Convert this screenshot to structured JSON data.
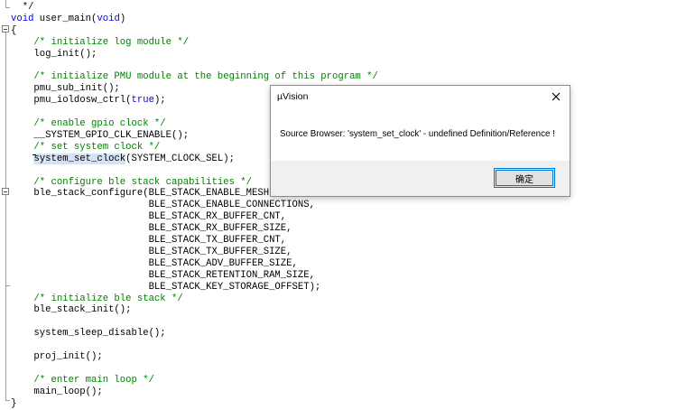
{
  "editor": {
    "lines": [
      {
        "segs": [
          {
            "t": "  */",
            "c": "plain"
          }
        ]
      },
      {
        "segs": [
          {
            "t": "void",
            "c": "keyword"
          },
          {
            "t": " user_main(",
            "c": "plain"
          },
          {
            "t": "void",
            "c": "keyword"
          },
          {
            "t": ")",
            "c": "plain"
          }
        ]
      },
      {
        "segs": [
          {
            "t": "{",
            "c": "plain"
          }
        ]
      },
      {
        "segs": [
          {
            "t": "    /* initialize log module */",
            "c": "comment"
          }
        ]
      },
      {
        "segs": [
          {
            "t": "    log_init();",
            "c": "plain"
          }
        ]
      },
      {
        "segs": [
          {
            "t": "",
            "c": "plain"
          }
        ]
      },
      {
        "segs": [
          {
            "t": "    /* initialize PMU module at the beginning of this program */",
            "c": "comment"
          }
        ]
      },
      {
        "segs": [
          {
            "t": "    pmu_sub_init();",
            "c": "plain"
          }
        ]
      },
      {
        "segs": [
          {
            "t": "    pmu_ioldosw_ctrl(",
            "c": "plain"
          },
          {
            "t": "true",
            "c": "keyword"
          },
          {
            "t": ");",
            "c": "plain"
          }
        ]
      },
      {
        "segs": [
          {
            "t": "",
            "c": "plain"
          }
        ]
      },
      {
        "segs": [
          {
            "t": "    /* enable gpio clock */",
            "c": "comment"
          }
        ]
      },
      {
        "segs": [
          {
            "t": "    __SYSTEM_GPIO_CLK_ENABLE();",
            "c": "plain"
          }
        ]
      },
      {
        "segs": [
          {
            "t": "    /* set system clock */",
            "c": "comment"
          }
        ]
      },
      {
        "segs": [
          {
            "t": "    ",
            "c": "plain"
          },
          {
            "t": "system_set_clock",
            "c": "sel"
          },
          {
            "t": "(SYSTEM_CLOCK_SEL);",
            "c": "plain"
          }
        ]
      },
      {
        "segs": [
          {
            "t": "",
            "c": "plain"
          }
        ]
      },
      {
        "segs": [
          {
            "t": "    /* configure ble stack capabilities */",
            "c": "comment"
          }
        ]
      },
      {
        "segs": [
          {
            "t": "    ble_stack_configure(BLE_STACK_ENABLE_MESH,",
            "c": "plain"
          }
        ]
      },
      {
        "segs": [
          {
            "t": "                        BLE_STACK_ENABLE_CONNECTIONS,",
            "c": "plain"
          }
        ]
      },
      {
        "segs": [
          {
            "t": "                        BLE_STACK_RX_BUFFER_CNT,",
            "c": "plain"
          }
        ]
      },
      {
        "segs": [
          {
            "t": "                        BLE_STACK_RX_BUFFER_SIZE,",
            "c": "plain"
          }
        ]
      },
      {
        "segs": [
          {
            "t": "                        BLE_STACK_TX_BUFFER_CNT,",
            "c": "plain"
          }
        ]
      },
      {
        "segs": [
          {
            "t": "                        BLE_STACK_TX_BUFFER_SIZE,",
            "c": "plain"
          }
        ]
      },
      {
        "segs": [
          {
            "t": "                        BLE_STACK_ADV_BUFFER_SIZE,",
            "c": "plain"
          }
        ]
      },
      {
        "segs": [
          {
            "t": "                        BLE_STACK_RETENTION_RAM_SIZE,",
            "c": "plain"
          }
        ]
      },
      {
        "segs": [
          {
            "t": "                        BLE_STACK_KEY_STORAGE_OFFSET);",
            "c": "plain"
          }
        ]
      },
      {
        "segs": [
          {
            "t": "    /* initialize ble stack */",
            "c": "comment"
          }
        ]
      },
      {
        "segs": [
          {
            "t": "    ble_stack_init();",
            "c": "plain"
          }
        ]
      },
      {
        "segs": [
          {
            "t": "",
            "c": "plain"
          }
        ]
      },
      {
        "segs": [
          {
            "t": "    system_sleep_disable();",
            "c": "plain"
          }
        ]
      },
      {
        "segs": [
          {
            "t": "",
            "c": "plain"
          }
        ]
      },
      {
        "segs": [
          {
            "t": "    proj_init();",
            "c": "plain"
          }
        ]
      },
      {
        "segs": [
          {
            "t": "",
            "c": "plain"
          }
        ]
      },
      {
        "segs": [
          {
            "t": "    /* enter main loop */",
            "c": "comment"
          }
        ]
      },
      {
        "segs": [
          {
            "t": "    main_loop();",
            "c": "plain"
          }
        ]
      },
      {
        "segs": [
          {
            "t": "}",
            "c": "plain"
          }
        ]
      }
    ]
  },
  "dialog": {
    "title": "µVision",
    "message": "Source Browser: 'system_set_clock' - undefined Definition/Reference !",
    "ok_label": "确定"
  },
  "colors": {
    "comment": "#008000",
    "keyword": "#0000ff",
    "selection": "#d3e3f3",
    "dialog_focus": "#0078d7"
  },
  "icons": {
    "close": "close-icon",
    "fold": "fold-toggle-icon"
  }
}
